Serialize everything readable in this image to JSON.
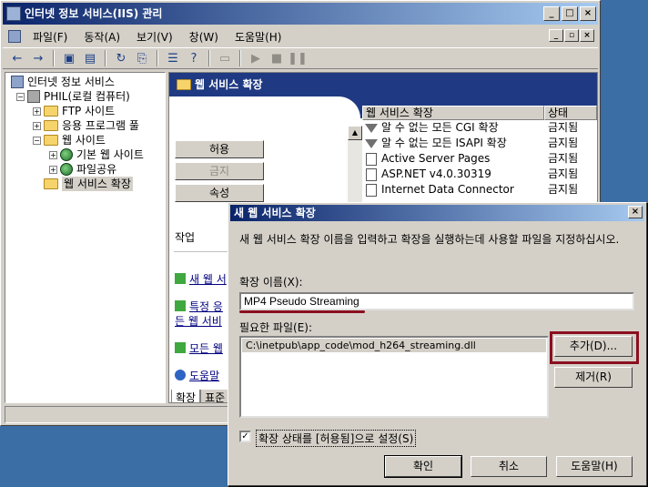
{
  "main_window": {
    "title": "인터넷 정보 서비스(IIS) 관리",
    "title_buttons": [
      "_",
      "□",
      "×"
    ],
    "menu": [
      "파일(F)",
      "동작(A)",
      "보기(V)",
      "창(W)",
      "도움말(H)"
    ],
    "mdi_buttons": [
      "_",
      "▫",
      "×"
    ],
    "toolbar_icons": [
      "back-arrow",
      "forward-arrow",
      "up-folder",
      "show-tree",
      "refresh",
      "export",
      "properties",
      "help",
      "computer",
      "play",
      "stop",
      "pause"
    ]
  },
  "tree": {
    "root": "인터넷 정보 서비스",
    "server": "PHIL(로컬 컴퓨터)",
    "ftp": "FTP 사이트",
    "app_pools": "응용 프로그램 풀",
    "web_sites": "웹 사이트",
    "default_site": "기본 웹 사이트",
    "file_share": "파일공유",
    "web_ext": "웹 서비스 확장"
  },
  "right_pane": {
    "banner": "웹 서비스 확장",
    "allow_btn": "허용",
    "deny_btn": "금지",
    "props_btn": "속성",
    "tasks_header": "작업",
    "task1": "새 웹 서",
    "task2a": "특정 응",
    "task2b": "든 웹 서비",
    "task3": "모든 웹",
    "task4": "도움말 ",
    "tab_ext": "확장",
    "tab_std": "표준"
  },
  "ext_list": {
    "col_name": "웹 서비스 확장",
    "col_status": "상태",
    "rows": [
      {
        "name": "알 수 없는 모든 CGI 확장",
        "status": "금지됨",
        "icon": "filter-icon"
      },
      {
        "name": "알 수 없는 모든 ISAPI 확장",
        "status": "금지됨",
        "icon": "filter-icon"
      },
      {
        "name": "Active Server Pages",
        "status": "금지됨",
        "icon": "document-icon"
      },
      {
        "name": "ASP.NET v4.0.30319",
        "status": "금지됨",
        "icon": "document-icon"
      },
      {
        "name": "Internet Data Connector",
        "status": "금지됨",
        "icon": "document-icon"
      }
    ]
  },
  "dialog": {
    "title": "새 웹 서비스 확장",
    "close": "×",
    "description": "새 웹 서비스 확장 이름을 입력하고 확장을 실행하는데 사용할 파일을 지정하십시오.",
    "name_label": "확장 이름(X):",
    "name_value": "MP4 Pseudo Streaming",
    "files_label": "필요한 파일(E):",
    "files": [
      "C:\\inetpub\\app_code\\mod_h264_streaming.dll"
    ],
    "add_btn": "추가(D)...",
    "remove_btn": "제거(R)",
    "checkbox_label": "확장 상태를 [허용됨]으로 설정(S)",
    "checkbox_checked": true,
    "ok_btn": "확인",
    "cancel_btn": "취소",
    "help_btn": "도움말(H)"
  },
  "colors": {
    "desktop": "#3a6ea5",
    "banner": "#1f3a82",
    "highlight_annotation": "#8b0f1f"
  }
}
